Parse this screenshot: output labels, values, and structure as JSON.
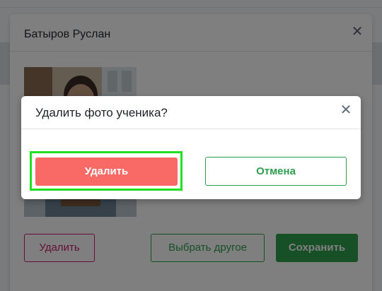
{
  "student_modal": {
    "title": "Батыров Руслан",
    "delete_label": "Удалить",
    "choose_label": "Выбрать другое",
    "save_label": "Сохранить"
  },
  "confirm_dialog": {
    "title": "Удалить фото ученика?",
    "confirm_label": "Удалить",
    "cancel_label": "Отмена"
  },
  "colors": {
    "delete_accent": "#c8206a",
    "green_accent": "#2e9e4f",
    "confirm_red": "#f96a66",
    "highlight": "#22e022"
  },
  "icons": {
    "close": "close-icon"
  }
}
